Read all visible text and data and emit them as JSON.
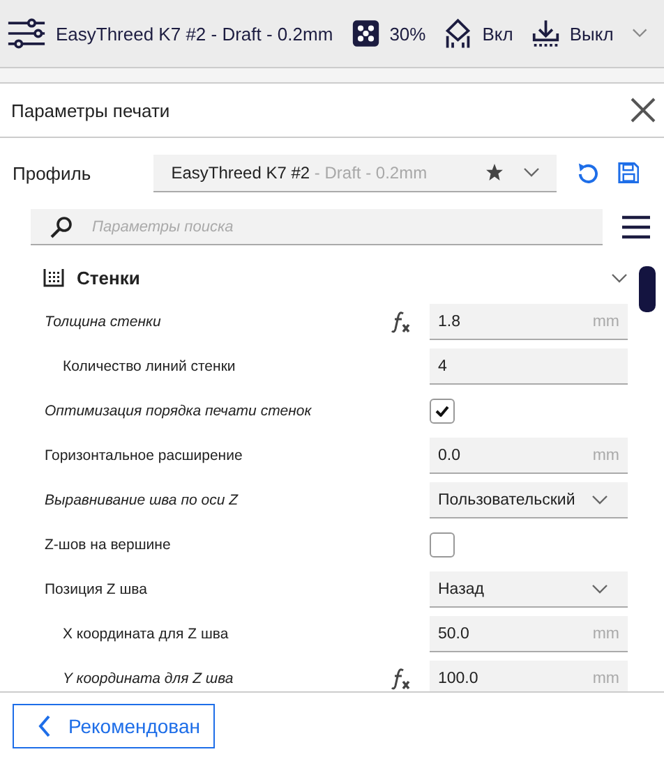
{
  "toolbar": {
    "profile": "EasyThreed K7 #2 - Draft - 0.2mm",
    "infill": "30%",
    "support": "Вкл",
    "adhesion": "Выкл"
  },
  "panel": {
    "title": "Параметры печати"
  },
  "profile": {
    "label": "Профиль",
    "name": "EasyThreed K7 #2",
    "suffix": " - Draft - 0.2mm"
  },
  "search": {
    "placeholder": "Параметры поиска"
  },
  "section": {
    "title": "Стенки",
    "expanded": true
  },
  "settings": [
    {
      "label": "Толщина стенки",
      "modified": true,
      "child": false,
      "formula": true,
      "kind": "number",
      "value": "1.8",
      "unit": "mm"
    },
    {
      "label": "Количество линий стенки",
      "modified": false,
      "child": true,
      "formula": false,
      "kind": "number",
      "value": "4"
    },
    {
      "label": "Оптимизация порядка печати стенок",
      "modified": true,
      "child": false,
      "formula": false,
      "kind": "checkbox",
      "checked": true
    },
    {
      "label": "Горизонтальное расширение",
      "modified": false,
      "child": false,
      "formula": false,
      "kind": "number",
      "value": "0.0",
      "unit": "mm"
    },
    {
      "label": "Выравнивание шва по оси Z",
      "modified": true,
      "child": false,
      "formula": false,
      "kind": "select",
      "value": "Пользовательский"
    },
    {
      "label": "Z-шов на вершине",
      "modified": false,
      "child": false,
      "formula": false,
      "kind": "checkbox",
      "checked": false
    },
    {
      "label": "Позиция Z шва",
      "modified": false,
      "child": false,
      "formula": false,
      "kind": "select",
      "value": "Назад"
    },
    {
      "label": "X координата для Z шва",
      "modified": false,
      "child": true,
      "formula": false,
      "kind": "number",
      "value": "50.0",
      "unit": "mm"
    },
    {
      "label": "Y координата для Z шва",
      "modified": true,
      "child": true,
      "formula": true,
      "kind": "number",
      "value": "100.0",
      "unit": "mm"
    }
  ],
  "footer": {
    "button": "Рекомендован"
  }
}
